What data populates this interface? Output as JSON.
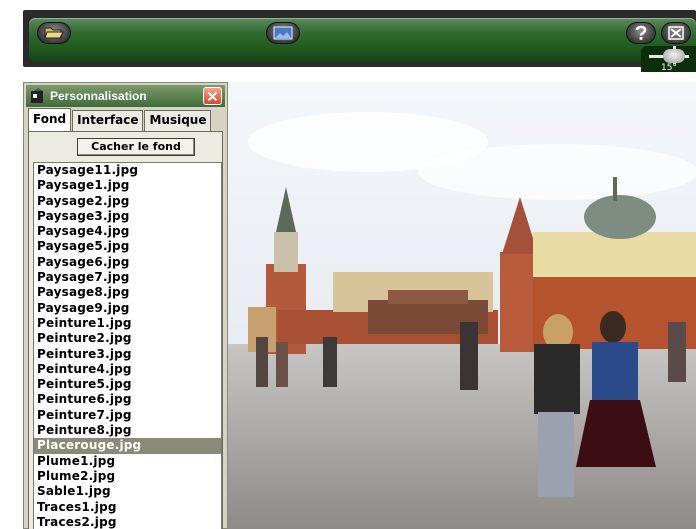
{
  "toolbar": {
    "buttons": [
      {
        "name": "open-folder",
        "icon": "folder-open-icon"
      },
      {
        "name": "image",
        "icon": "image-icon"
      },
      {
        "name": "help",
        "icon": "help-icon"
      },
      {
        "name": "close",
        "icon": "close-icon"
      }
    ],
    "zoom_label": "15°"
  },
  "panel": {
    "title": "Personnalisation",
    "tabs": [
      {
        "label": "Fond",
        "active": true
      },
      {
        "label": "Interface",
        "active": false
      },
      {
        "label": "Musique",
        "active": false
      }
    ],
    "hide_button_label": "Cacher le fond",
    "files": [
      "Paysage11.jpg",
      "Paysage1.jpg",
      "Paysage2.jpg",
      "Paysage3.jpg",
      "Paysage4.jpg",
      "Paysage5.jpg",
      "Paysage6.jpg",
      "Paysage7.jpg",
      "Paysage8.jpg",
      "Paysage9.jpg",
      "Peinture1.jpg",
      "Peinture2.jpg",
      "Peinture3.jpg",
      "Peinture4.jpg",
      "Peinture5.jpg",
      "Peinture6.jpg",
      "Peinture7.jpg",
      "Peinture8.jpg",
      "Placerouge.jpg",
      "Plume1.jpg",
      "Plume2.jpg",
      "Sable1.jpg",
      "Traces1.jpg",
      "Traces2.jpg"
    ],
    "selected_file": "Placerouge.jpg"
  },
  "colors": {
    "toolbar_green": "#2f6a2f",
    "panel_title_green": "#3f6b3a",
    "close_red": "#d9472a",
    "selection_gray": "#8a8a78"
  }
}
